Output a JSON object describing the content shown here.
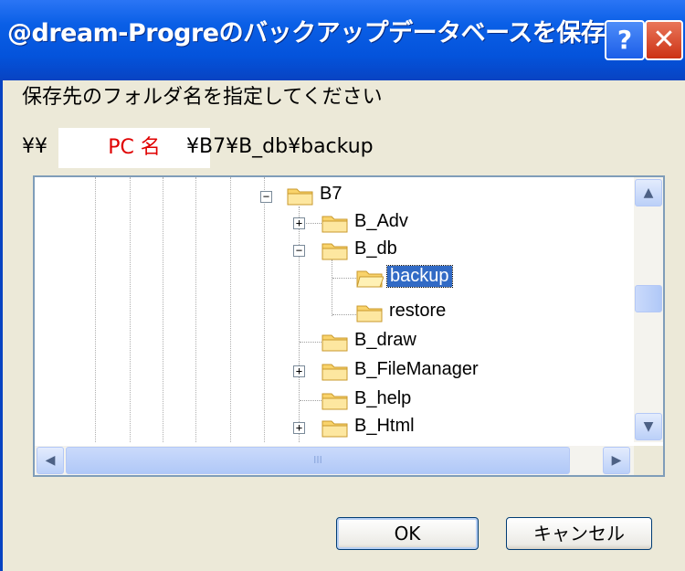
{
  "window": {
    "title": "@dream-Progreのバックアップデータベースを保存",
    "help_label": "?",
    "close_label": "✕"
  },
  "prompt": "保存先のフォルダ名を指定してください",
  "path": {
    "prefix": "¥¥",
    "pc_name": "PC 名",
    "suffix": "¥B7¥B_db¥backup"
  },
  "tree": {
    "items": [
      {
        "label": "B7",
        "expander": "−"
      },
      {
        "label": "B_Adv",
        "expander": "+"
      },
      {
        "label": "B_db",
        "expander": "−"
      },
      {
        "label": "backup",
        "expander": "",
        "selected": true
      },
      {
        "label": "restore",
        "expander": ""
      },
      {
        "label": "B_draw",
        "expander": ""
      },
      {
        "label": "B_FileManager",
        "expander": "+"
      },
      {
        "label": "B_help",
        "expander": ""
      },
      {
        "label": "B_Html",
        "expander": "+"
      }
    ]
  },
  "scrollbar": {
    "hthumb_grip": "III"
  },
  "buttons": {
    "ok_label": "OK",
    "cancel_label": "キャンセル"
  },
  "colors": {
    "titlebar": "#0453DB",
    "selection": "#316AC5",
    "pc_name_text": "#E00000"
  }
}
